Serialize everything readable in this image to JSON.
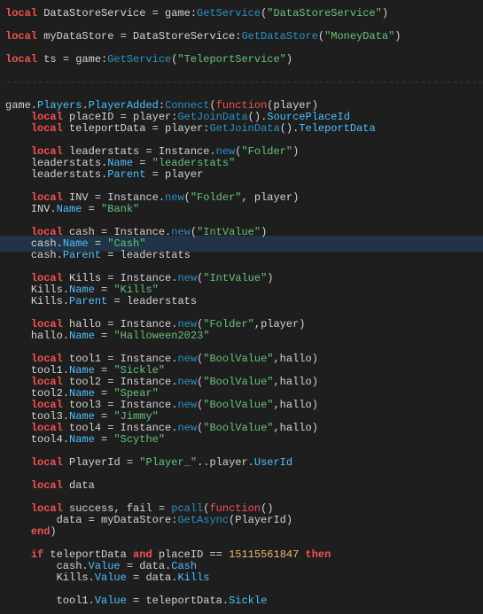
{
  "lines": [
    {
      "t": "code",
      "tokens": [
        {
          "c": "kw",
          "v": "local"
        },
        {
          "c": "pl",
          "v": " DataStoreService = game:"
        },
        {
          "c": "fn",
          "v": "GetService"
        },
        {
          "c": "pl",
          "v": "("
        },
        {
          "c": "str",
          "v": "\"DataStoreService\""
        },
        {
          "c": "pl",
          "v": ")"
        }
      ]
    },
    {
      "t": "blank"
    },
    {
      "t": "code",
      "tokens": [
        {
          "c": "kw",
          "v": "local"
        },
        {
          "c": "pl",
          "v": " myDataStore = DataStoreService:"
        },
        {
          "c": "fn",
          "v": "GetDataStore"
        },
        {
          "c": "pl",
          "v": "("
        },
        {
          "c": "str",
          "v": "\"MoneyData\""
        },
        {
          "c": "pl",
          "v": ")"
        }
      ]
    },
    {
      "t": "blank"
    },
    {
      "t": "code",
      "tokens": [
        {
          "c": "kw",
          "v": "local"
        },
        {
          "c": "pl",
          "v": " ts = game:"
        },
        {
          "c": "fn",
          "v": "GetService"
        },
        {
          "c": "pl",
          "v": "("
        },
        {
          "c": "str",
          "v": "\"TeleportService\""
        },
        {
          "c": "pl",
          "v": ")"
        }
      ]
    },
    {
      "t": "blank"
    },
    {
      "t": "dashes"
    },
    {
      "t": "blank"
    },
    {
      "t": "code",
      "tokens": [
        {
          "c": "pl",
          "v": "game."
        },
        {
          "c": "prop",
          "v": "Players"
        },
        {
          "c": "pl",
          "v": "."
        },
        {
          "c": "prop",
          "v": "PlayerAdded"
        },
        {
          "c": "pl",
          "v": ":"
        },
        {
          "c": "fn",
          "v": "Connect"
        },
        {
          "c": "pl",
          "v": "("
        },
        {
          "c": "kw2",
          "v": "function"
        },
        {
          "c": "pl",
          "v": "(player)"
        }
      ]
    },
    {
      "t": "code",
      "indent": 1,
      "tokens": [
        {
          "c": "kw",
          "v": "local"
        },
        {
          "c": "pl",
          "v": " placeID = player:"
        },
        {
          "c": "fn",
          "v": "GetJoinData"
        },
        {
          "c": "pl",
          "v": "()."
        },
        {
          "c": "prop",
          "v": "SourcePlaceId"
        }
      ]
    },
    {
      "t": "code",
      "indent": 1,
      "tokens": [
        {
          "c": "kw",
          "v": "local"
        },
        {
          "c": "pl",
          "v": " teleportData = player:"
        },
        {
          "c": "fn",
          "v": "GetJoinData"
        },
        {
          "c": "pl",
          "v": "()."
        },
        {
          "c": "prop",
          "v": "TeleportData"
        }
      ]
    },
    {
      "t": "blank"
    },
    {
      "t": "code",
      "indent": 1,
      "tokens": [
        {
          "c": "kw",
          "v": "local"
        },
        {
          "c": "pl",
          "v": " leaderstats = Instance."
        },
        {
          "c": "fn",
          "v": "new"
        },
        {
          "c": "pl",
          "v": "("
        },
        {
          "c": "str",
          "v": "\"Folder\""
        },
        {
          "c": "pl",
          "v": ")"
        }
      ]
    },
    {
      "t": "code",
      "indent": 1,
      "tokens": [
        {
          "c": "pl",
          "v": "leaderstats."
        },
        {
          "c": "prop",
          "v": "Name"
        },
        {
          "c": "pl",
          "v": " = "
        },
        {
          "c": "str",
          "v": "\"leaderstats\""
        }
      ]
    },
    {
      "t": "code",
      "indent": 1,
      "tokens": [
        {
          "c": "pl",
          "v": "leaderstats."
        },
        {
          "c": "prop",
          "v": "Parent"
        },
        {
          "c": "pl",
          "v": " = player"
        }
      ]
    },
    {
      "t": "blank"
    },
    {
      "t": "code",
      "indent": 1,
      "tokens": [
        {
          "c": "kw",
          "v": "local"
        },
        {
          "c": "pl",
          "v": " INV = Instance."
        },
        {
          "c": "fn",
          "v": "new"
        },
        {
          "c": "pl",
          "v": "("
        },
        {
          "c": "str",
          "v": "\"Folder\""
        },
        {
          "c": "pl",
          "v": ", player)"
        }
      ]
    },
    {
      "t": "code",
      "indent": 1,
      "tokens": [
        {
          "c": "pl",
          "v": "INV."
        },
        {
          "c": "prop",
          "v": "Name"
        },
        {
          "c": "pl",
          "v": " = "
        },
        {
          "c": "str",
          "v": "\"Bank\""
        }
      ]
    },
    {
      "t": "blank"
    },
    {
      "t": "code",
      "indent": 1,
      "tokens": [
        {
          "c": "kw",
          "v": "local"
        },
        {
          "c": "pl",
          "v": " cash = Instance."
        },
        {
          "c": "fn",
          "v": "new"
        },
        {
          "c": "pl",
          "v": "("
        },
        {
          "c": "str",
          "v": "\"IntValue\""
        },
        {
          "c": "pl",
          "v": ")"
        }
      ]
    },
    {
      "t": "code",
      "indent": 1,
      "highlight": true,
      "tokens": [
        {
          "c": "pl",
          "v": "cash."
        },
        {
          "c": "prop",
          "v": "Name"
        },
        {
          "c": "pl",
          "v": " = "
        },
        {
          "c": "str",
          "v": "\"Cash\""
        }
      ]
    },
    {
      "t": "code",
      "indent": 1,
      "tokens": [
        {
          "c": "pl",
          "v": "cash."
        },
        {
          "c": "prop",
          "v": "Parent"
        },
        {
          "c": "pl",
          "v": " = leaderstats"
        }
      ]
    },
    {
      "t": "blank"
    },
    {
      "t": "code",
      "indent": 1,
      "tokens": [
        {
          "c": "kw",
          "v": "local"
        },
        {
          "c": "pl",
          "v": " Kills = Instance."
        },
        {
          "c": "fn",
          "v": "new"
        },
        {
          "c": "pl",
          "v": "("
        },
        {
          "c": "str",
          "v": "\"IntValue\""
        },
        {
          "c": "pl",
          "v": ")"
        }
      ]
    },
    {
      "t": "code",
      "indent": 1,
      "tokens": [
        {
          "c": "pl",
          "v": "Kills."
        },
        {
          "c": "prop",
          "v": "Name"
        },
        {
          "c": "pl",
          "v": " = "
        },
        {
          "c": "str",
          "v": "\"Kills\""
        }
      ]
    },
    {
      "t": "code",
      "indent": 1,
      "tokens": [
        {
          "c": "pl",
          "v": "Kills."
        },
        {
          "c": "prop",
          "v": "Parent"
        },
        {
          "c": "pl",
          "v": " = leaderstats"
        }
      ]
    },
    {
      "t": "blank"
    },
    {
      "t": "code",
      "indent": 1,
      "tokens": [
        {
          "c": "kw",
          "v": "local"
        },
        {
          "c": "pl",
          "v": " hallo = Instance."
        },
        {
          "c": "fn",
          "v": "new"
        },
        {
          "c": "pl",
          "v": "("
        },
        {
          "c": "str",
          "v": "\"Folder\""
        },
        {
          "c": "pl",
          "v": ",player)"
        }
      ]
    },
    {
      "t": "code",
      "indent": 1,
      "tokens": [
        {
          "c": "pl",
          "v": "hallo."
        },
        {
          "c": "prop",
          "v": "Name"
        },
        {
          "c": "pl",
          "v": " = "
        },
        {
          "c": "str",
          "v": "\"Halloween2023\""
        }
      ]
    },
    {
      "t": "blank"
    },
    {
      "t": "code",
      "indent": 1,
      "tokens": [
        {
          "c": "kw",
          "v": "local"
        },
        {
          "c": "pl",
          "v": " tool1 = Instance."
        },
        {
          "c": "fn",
          "v": "new"
        },
        {
          "c": "pl",
          "v": "("
        },
        {
          "c": "str",
          "v": "\"BoolValue\""
        },
        {
          "c": "pl",
          "v": ",hallo)"
        }
      ]
    },
    {
      "t": "code",
      "indent": 1,
      "tokens": [
        {
          "c": "pl",
          "v": "tool1."
        },
        {
          "c": "prop",
          "v": "Name"
        },
        {
          "c": "pl",
          "v": " = "
        },
        {
          "c": "str",
          "v": "\"Sickle\""
        }
      ]
    },
    {
      "t": "code",
      "indent": 1,
      "tokens": [
        {
          "c": "kw",
          "v": "local"
        },
        {
          "c": "pl",
          "v": " tool2 = Instance."
        },
        {
          "c": "fn",
          "v": "new"
        },
        {
          "c": "pl",
          "v": "("
        },
        {
          "c": "str",
          "v": "\"BoolValue\""
        },
        {
          "c": "pl",
          "v": ",hallo)"
        }
      ]
    },
    {
      "t": "code",
      "indent": 1,
      "tokens": [
        {
          "c": "pl",
          "v": "tool2."
        },
        {
          "c": "prop",
          "v": "Name"
        },
        {
          "c": "pl",
          "v": " = "
        },
        {
          "c": "str",
          "v": "\"Spear\""
        }
      ]
    },
    {
      "t": "code",
      "indent": 1,
      "tokens": [
        {
          "c": "kw",
          "v": "local"
        },
        {
          "c": "pl",
          "v": " tool3 = Instance."
        },
        {
          "c": "fn",
          "v": "new"
        },
        {
          "c": "pl",
          "v": "("
        },
        {
          "c": "str",
          "v": "\"BoolValue\""
        },
        {
          "c": "pl",
          "v": ",hallo)"
        }
      ]
    },
    {
      "t": "code",
      "indent": 1,
      "tokens": [
        {
          "c": "pl",
          "v": "tool3."
        },
        {
          "c": "prop",
          "v": "Name"
        },
        {
          "c": "pl",
          "v": " = "
        },
        {
          "c": "str",
          "v": "\"Jimmy\""
        }
      ]
    },
    {
      "t": "code",
      "indent": 1,
      "tokens": [
        {
          "c": "kw",
          "v": "local"
        },
        {
          "c": "pl",
          "v": " tool4 = Instance."
        },
        {
          "c": "fn",
          "v": "new"
        },
        {
          "c": "pl",
          "v": "("
        },
        {
          "c": "str",
          "v": "\"BoolValue\""
        },
        {
          "c": "pl",
          "v": ",hallo)"
        }
      ]
    },
    {
      "t": "code",
      "indent": 1,
      "tokens": [
        {
          "c": "pl",
          "v": "tool4."
        },
        {
          "c": "prop",
          "v": "Name"
        },
        {
          "c": "pl",
          "v": " = "
        },
        {
          "c": "str",
          "v": "\"Scythe\""
        }
      ]
    },
    {
      "t": "blank"
    },
    {
      "t": "code",
      "indent": 1,
      "tokens": [
        {
          "c": "kw",
          "v": "local"
        },
        {
          "c": "pl",
          "v": " PlayerId = "
        },
        {
          "c": "str",
          "v": "\"Player_\""
        },
        {
          "c": "pl",
          "v": "..player."
        },
        {
          "c": "prop",
          "v": "UserId"
        }
      ]
    },
    {
      "t": "blank"
    },
    {
      "t": "code",
      "indent": 1,
      "tokens": [
        {
          "c": "kw",
          "v": "local"
        },
        {
          "c": "pl",
          "v": " data"
        }
      ]
    },
    {
      "t": "blank"
    },
    {
      "t": "code",
      "indent": 1,
      "tokens": [
        {
          "c": "kw",
          "v": "local"
        },
        {
          "c": "pl",
          "v": " success, fail = "
        },
        {
          "c": "fn",
          "v": "pcall"
        },
        {
          "c": "pl",
          "v": "("
        },
        {
          "c": "kw2",
          "v": "function"
        },
        {
          "c": "pl",
          "v": "()"
        }
      ]
    },
    {
      "t": "code",
      "indent": 2,
      "tokens": [
        {
          "c": "pl",
          "v": "data = myDataStore:"
        },
        {
          "c": "fn",
          "v": "GetAsync"
        },
        {
          "c": "pl",
          "v": "(PlayerId)"
        }
      ]
    },
    {
      "t": "code",
      "indent": 1,
      "tokens": [
        {
          "c": "kw",
          "v": "end"
        },
        {
          "c": "pl",
          "v": ")"
        }
      ]
    },
    {
      "t": "blank"
    },
    {
      "t": "code",
      "indent": 1,
      "tokens": [
        {
          "c": "kw",
          "v": "if"
        },
        {
          "c": "pl",
          "v": " teleportData "
        },
        {
          "c": "kw",
          "v": "and"
        },
        {
          "c": "pl",
          "v": " placeID == "
        },
        {
          "c": "num",
          "v": "15115561847"
        },
        {
          "c": "pl",
          "v": " "
        },
        {
          "c": "kw",
          "v": "then"
        }
      ]
    },
    {
      "t": "code",
      "indent": 2,
      "tokens": [
        {
          "c": "pl",
          "v": "cash."
        },
        {
          "c": "prop",
          "v": "Value"
        },
        {
          "c": "pl",
          "v": " = data."
        },
        {
          "c": "prop",
          "v": "Cash"
        }
      ]
    },
    {
      "t": "code",
      "indent": 2,
      "tokens": [
        {
          "c": "pl",
          "v": "Kills."
        },
        {
          "c": "prop",
          "v": "Value"
        },
        {
          "c": "pl",
          "v": " = data."
        },
        {
          "c": "prop",
          "v": "Kills"
        }
      ]
    },
    {
      "t": "blank"
    },
    {
      "t": "code",
      "indent": 2,
      "tokens": [
        {
          "c": "pl",
          "v": "tool1."
        },
        {
          "c": "prop",
          "v": "Value"
        },
        {
          "c": "pl",
          "v": " = teleportData."
        },
        {
          "c": "prop",
          "v": "Sickle"
        }
      ]
    }
  ]
}
